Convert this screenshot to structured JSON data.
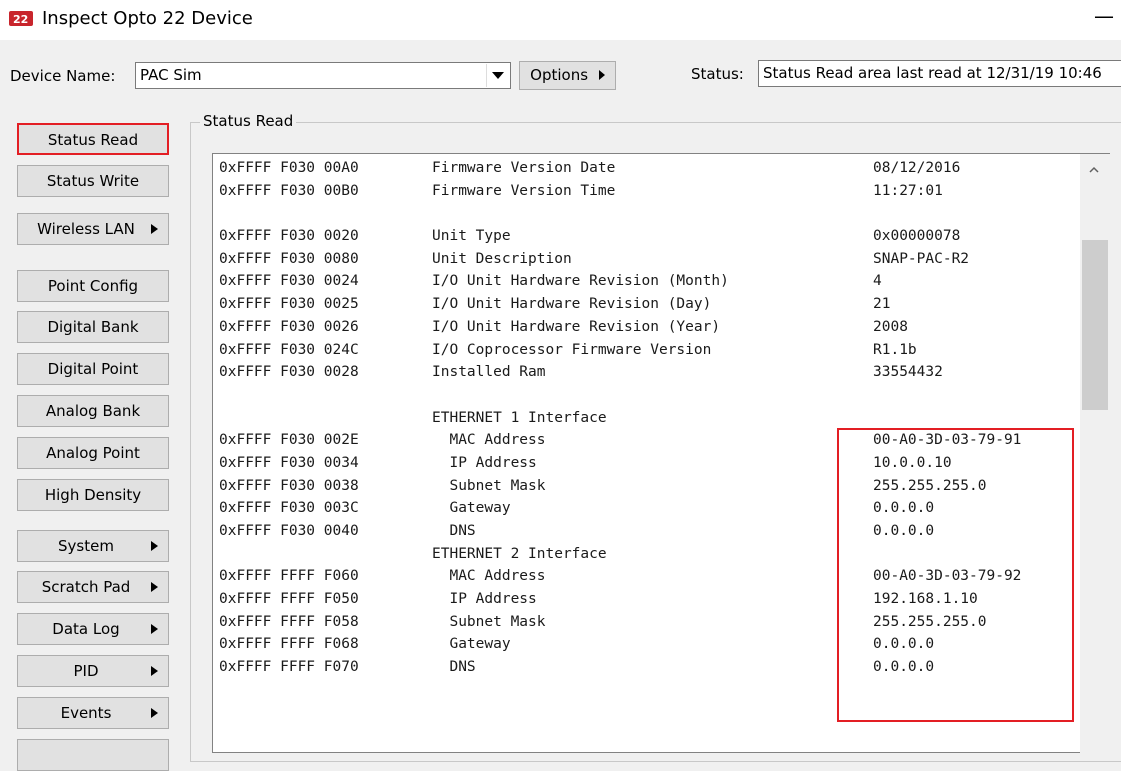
{
  "window": {
    "title": "Inspect Opto 22 Device",
    "minimize_glyph": "—",
    "icon": "opto22-logo-icon"
  },
  "device": {
    "label": "Device Name:",
    "value": "PAC Sim",
    "options_label": "Options"
  },
  "status": {
    "label": "Status:",
    "value": "Status Read area last read at 12/31/19 10:46"
  },
  "sidebar": {
    "items": [
      {
        "label": "Status Read",
        "submenu": false,
        "selected": true
      },
      {
        "label": "Status Write",
        "submenu": false
      },
      {
        "label": "Wireless LAN",
        "submenu": true
      },
      {
        "label": "Point Config",
        "submenu": false
      },
      {
        "label": "Digital Bank",
        "submenu": false
      },
      {
        "label": "Digital Point",
        "submenu": false
      },
      {
        "label": "Analog Bank",
        "submenu": false
      },
      {
        "label": "Analog Point",
        "submenu": false
      },
      {
        "label": "High Density",
        "submenu": false
      },
      {
        "label": "System",
        "submenu": true
      },
      {
        "label": "Scratch Pad",
        "submenu": true
      },
      {
        "label": "Data Log",
        "submenu": true
      },
      {
        "label": "PID",
        "submenu": true
      },
      {
        "label": "Events",
        "submenu": true
      }
    ]
  },
  "group": {
    "title": "Status Read"
  },
  "listing": {
    "rows": [
      {
        "addr": "0xFFFF F030 00A0",
        "desc": "Firmware Version Date",
        "value": "08/12/2016"
      },
      {
        "addr": "0xFFFF F030 00B0",
        "desc": "Firmware Version Time",
        "value": "11:27:01"
      },
      {
        "addr": "",
        "desc": "",
        "value": ""
      },
      {
        "addr": "0xFFFF F030 0020",
        "desc": "Unit Type",
        "value": "0x00000078"
      },
      {
        "addr": "0xFFFF F030 0080",
        "desc": "Unit Description",
        "value": "SNAP-PAC-R2"
      },
      {
        "addr": "0xFFFF F030 0024",
        "desc": "I/O Unit Hardware Revision (Month)",
        "value": "4"
      },
      {
        "addr": "0xFFFF F030 0025",
        "desc": "I/O Unit Hardware Revision (Day)",
        "value": "21"
      },
      {
        "addr": "0xFFFF F030 0026",
        "desc": "I/O Unit Hardware Revision (Year)",
        "value": "2008"
      },
      {
        "addr": "0xFFFF F030 024C",
        "desc": "I/O Coprocessor Firmware Version",
        "value": "R1.1b"
      },
      {
        "addr": "0xFFFF F030 0028",
        "desc": "Installed Ram",
        "value": "33554432"
      },
      {
        "addr": "",
        "desc": "",
        "value": ""
      },
      {
        "addr": "",
        "desc": "ETHERNET 1 Interface",
        "value": ""
      },
      {
        "addr": "0xFFFF F030 002E",
        "desc": "  MAC Address",
        "value": "00-A0-3D-03-79-91"
      },
      {
        "addr": "0xFFFF F030 0034",
        "desc": "  IP Address",
        "value": "10.0.0.10"
      },
      {
        "addr": "0xFFFF F030 0038",
        "desc": "  Subnet Mask",
        "value": "255.255.255.0"
      },
      {
        "addr": "0xFFFF F030 003C",
        "desc": "  Gateway",
        "value": "0.0.0.0"
      },
      {
        "addr": "0xFFFF F030 0040",
        "desc": "  DNS",
        "value": "0.0.0.0"
      },
      {
        "addr": "",
        "desc": "ETHERNET 2 Interface",
        "value": ""
      },
      {
        "addr": "0xFFFF FFFF F060",
        "desc": "  MAC Address",
        "value": "00-A0-3D-03-79-92"
      },
      {
        "addr": "0xFFFF FFFF F050",
        "desc": "  IP Address",
        "value": "192.168.1.10"
      },
      {
        "addr": "0xFFFF FFFF F058",
        "desc": "  Subnet Mask",
        "value": "255.255.255.0"
      },
      {
        "addr": "0xFFFF FFFF F068",
        "desc": "  Gateway",
        "value": "0.0.0.0"
      },
      {
        "addr": "0xFFFF FFFF F070",
        "desc": "  DNS",
        "value": "0.0.0.0"
      }
    ]
  },
  "colors": {
    "highlight": "#e31e24",
    "logo": "#c8252c"
  }
}
